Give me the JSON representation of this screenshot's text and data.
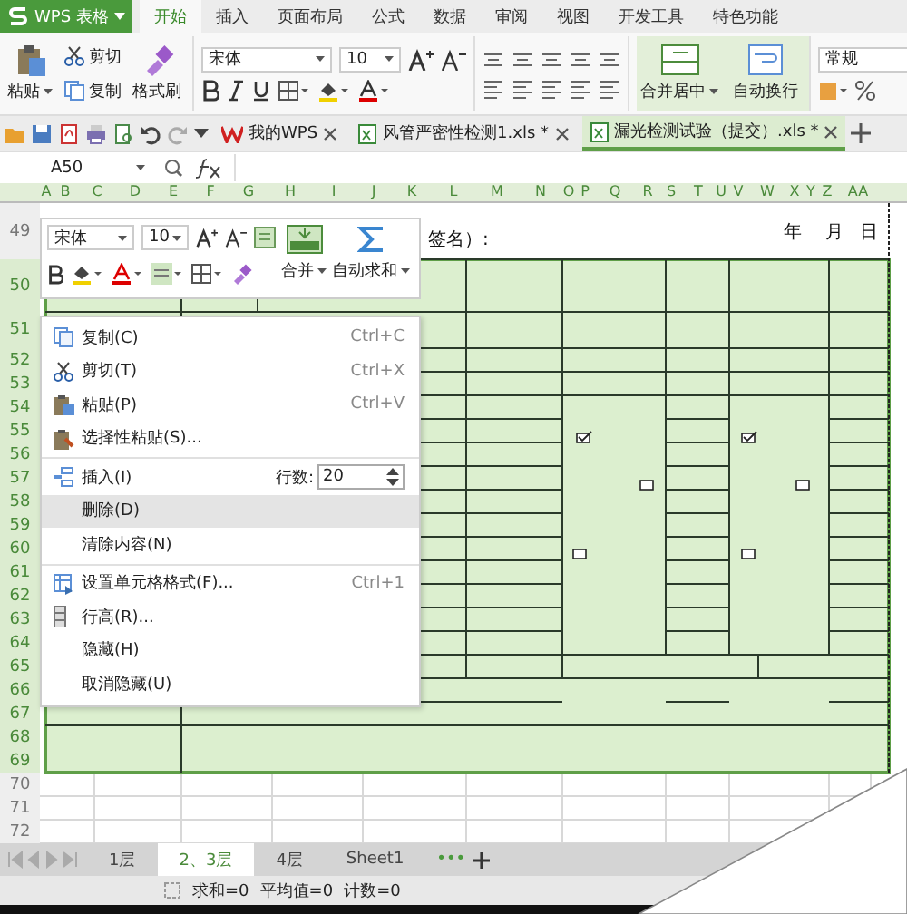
{
  "app_menu": {
    "label": "WPS 表格"
  },
  "ribbon_tabs": [
    {
      "label": "开始",
      "selected": true
    },
    {
      "label": "插入",
      "selected": false
    },
    {
      "label": "页面布局",
      "selected": false
    },
    {
      "label": "公式",
      "selected": false
    },
    {
      "label": "数据",
      "selected": false
    },
    {
      "label": "审阅",
      "selected": false
    },
    {
      "label": "视图",
      "selected": false
    },
    {
      "label": "开发工具",
      "selected": false
    },
    {
      "label": "特色功能",
      "selected": false
    }
  ],
  "ribbon": {
    "paste": "粘贴",
    "cut": "剪切",
    "copy": "复制",
    "format_painter": "格式刷",
    "font": "宋体",
    "font_size": "10",
    "merge_center": "合并居中",
    "wrap_text": "自动换行",
    "number_format": "常规"
  },
  "doc_tabs": [
    {
      "title": "我的WPS",
      "selected": false
    },
    {
      "title": "风管严密性检测1.xls *",
      "selected": false
    },
    {
      "title": "漏光检测试验（提交）.xls *",
      "selected": true
    }
  ],
  "formula_bar": {
    "cell_ref": "A50"
  },
  "columns": [
    {
      "label": "A",
      "selected": true
    },
    {
      "label": "B",
      "selected": true
    },
    {
      "label": "C",
      "selected": true
    },
    {
      "label": "D",
      "selected": true
    },
    {
      "label": "E",
      "selected": true
    },
    {
      "label": "F",
      "selected": true
    },
    {
      "label": "G",
      "selected": true
    },
    {
      "label": "H",
      "selected": true
    },
    {
      "label": "I",
      "selected": true
    },
    {
      "label": "J",
      "selected": true
    },
    {
      "label": "K",
      "selected": true
    },
    {
      "label": "L",
      "selected": true
    },
    {
      "label": "M",
      "selected": true
    },
    {
      "label": "N",
      "selected": true
    },
    {
      "label": "O",
      "selected": true
    },
    {
      "label": "P",
      "selected": true
    },
    {
      "label": "Q",
      "selected": true
    },
    {
      "label": "R",
      "selected": true
    },
    {
      "label": "S",
      "selected": true
    },
    {
      "label": "T",
      "selected": true
    },
    {
      "label": "U",
      "selected": true
    },
    {
      "label": "V",
      "selected": true
    },
    {
      "label": "W",
      "selected": true
    },
    {
      "label": "X",
      "selected": true
    },
    {
      "label": "Y",
      "selected": true
    },
    {
      "label": "Z",
      "selected": true
    },
    {
      "label": "AA",
      "selected": true
    }
  ],
  "rows": [
    {
      "label": "49",
      "selected": false
    },
    {
      "label": "50",
      "selected": true
    },
    {
      "label": "51",
      "selected": true
    },
    {
      "label": "52",
      "selected": true
    },
    {
      "label": "53",
      "selected": true
    },
    {
      "label": "54",
      "selected": true
    },
    {
      "label": "55",
      "selected": true
    },
    {
      "label": "56",
      "selected": true
    },
    {
      "label": "57",
      "selected": true
    },
    {
      "label": "58",
      "selected": true
    },
    {
      "label": "59",
      "selected": true
    },
    {
      "label": "60",
      "selected": true
    },
    {
      "label": "61",
      "selected": true
    },
    {
      "label": "62",
      "selected": true
    },
    {
      "label": "63",
      "selected": true
    },
    {
      "label": "64",
      "selected": true
    },
    {
      "label": "65",
      "selected": true
    },
    {
      "label": "66",
      "selected": true
    },
    {
      "label": "67",
      "selected": true
    },
    {
      "label": "68",
      "selected": true
    },
    {
      "label": "69",
      "selected": true
    },
    {
      "label": "70",
      "selected": false
    },
    {
      "label": "71",
      "selected": false
    },
    {
      "label": "72",
      "selected": false
    }
  ],
  "cells": [
    {
      "text": "签名）:"
    },
    {
      "text": "年"
    },
    {
      "text": "月"
    },
    {
      "text": "日"
    }
  ],
  "checkboxes": [
    {
      "checked": true
    },
    {
      "checked": true
    },
    {
      "checked": false
    },
    {
      "checked": false
    },
    {
      "checked": false
    },
    {
      "checked": false
    }
  ],
  "mini_toolbar": {
    "font": "宋体",
    "font_size": "10",
    "merge": "合并",
    "autosum": "自动求和"
  },
  "context_menu": [
    {
      "kind": "item",
      "label": "复制(C)",
      "shortcut": "Ctrl+C",
      "selected": false
    },
    {
      "kind": "item",
      "label": "剪切(T)",
      "shortcut": "Ctrl+X",
      "selected": false
    },
    {
      "kind": "item",
      "label": "粘贴(P)",
      "shortcut": "Ctrl+V",
      "selected": false
    },
    {
      "kind": "item",
      "label": "选择性粘贴(S)...",
      "selected": false
    },
    {
      "kind": "separator"
    },
    {
      "kind": "insert",
      "label": "插入(I)",
      "rows_label": "行数:",
      "rows_value": "20",
      "selected": false
    },
    {
      "kind": "item",
      "label": "删除(D)",
      "selected": true
    },
    {
      "kind": "item",
      "label": "清除内容(N)",
      "selected": false
    },
    {
      "kind": "separator"
    },
    {
      "kind": "item",
      "label": "设置单元格格式(F)...",
      "shortcut": "Ctrl+1",
      "selected": false
    },
    {
      "kind": "item",
      "label": "行高(R)...",
      "selected": false
    },
    {
      "kind": "item",
      "label": "隐藏(H)",
      "selected": false
    },
    {
      "kind": "item",
      "label": "取消隐藏(U)",
      "selected": false
    }
  ],
  "sheet_tabs": [
    {
      "label": "1层",
      "selected": false
    },
    {
      "label": "2、3层",
      "selected": true
    },
    {
      "label": "4层",
      "selected": false
    },
    {
      "label": "Sheet1",
      "selected": false
    }
  ],
  "sheet_more": "•••",
  "status_bar": [
    "求和=0",
    "平均值=0",
    "计数=0"
  ]
}
